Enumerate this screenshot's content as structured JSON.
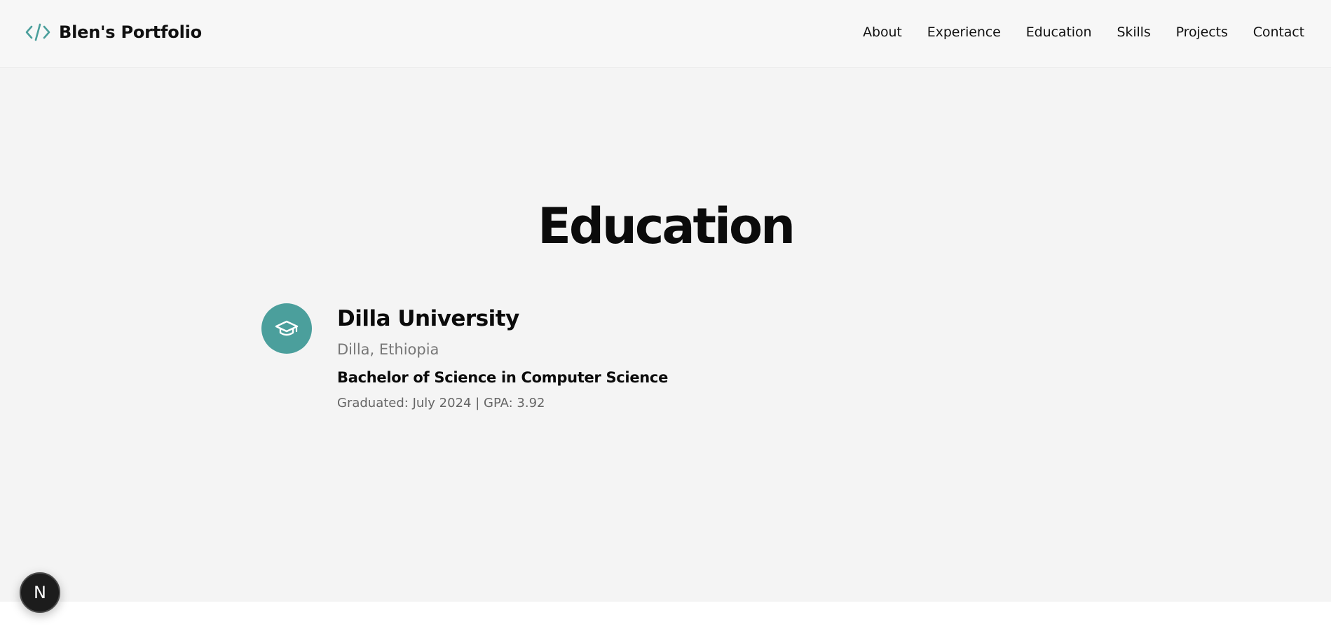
{
  "header": {
    "brand_name": "Blen's Portfolio",
    "brand_icon": "code-brackets-icon",
    "nav_items": [
      {
        "label": "About"
      },
      {
        "label": "Experience"
      },
      {
        "label": "Education"
      },
      {
        "label": "Skills"
      },
      {
        "label": "Projects"
      },
      {
        "label": "Contact"
      }
    ]
  },
  "education": {
    "title": "Education",
    "entries": [
      {
        "icon": "graduation-cap-icon",
        "school": "Dilla University",
        "location": "Dilla, Ethiopia",
        "degree": "Bachelor of Science in Computer Science",
        "details": "Graduated: July 2024 | GPA: 3.92"
      }
    ]
  },
  "dev_badge": {
    "label": "N",
    "icon": "nextjs-logo-icon"
  },
  "colors": {
    "accent": "#4b9f9c",
    "header_bg": "#f7f7f7",
    "section_bg": "#f4f4f4",
    "text": "#0b0b0b",
    "muted_text": "#777777"
  }
}
